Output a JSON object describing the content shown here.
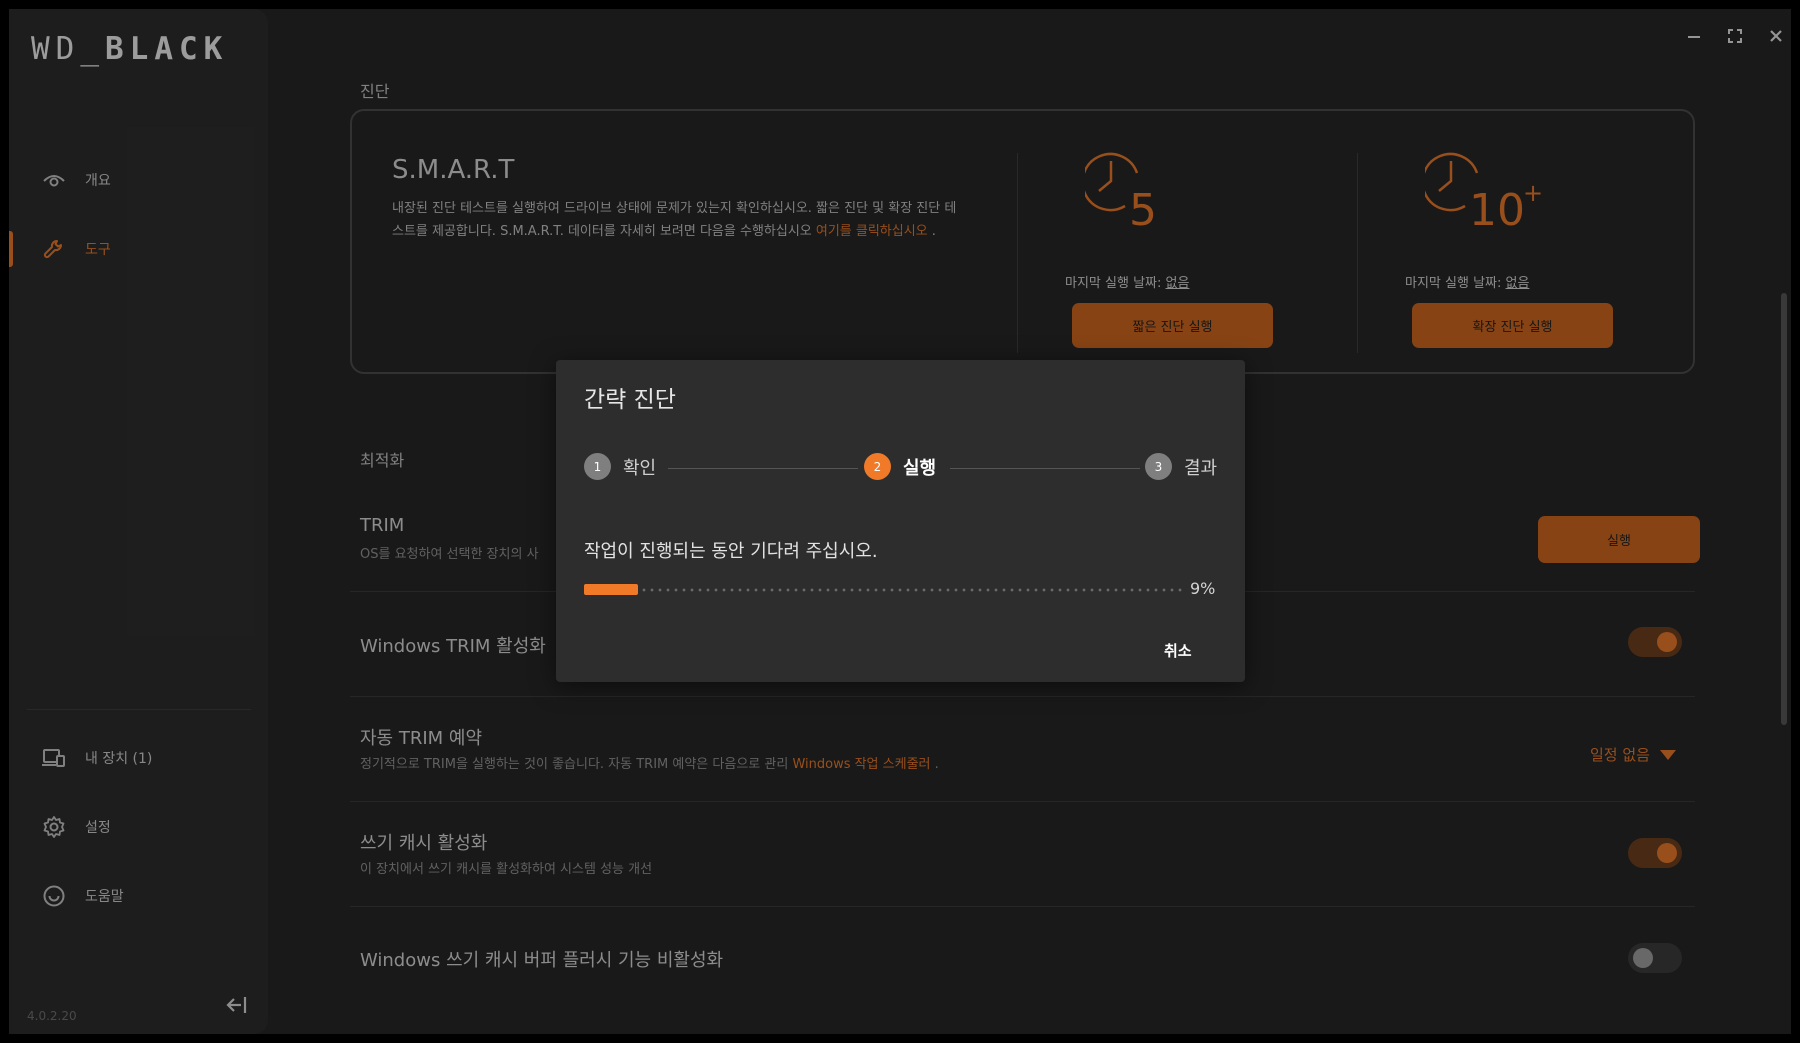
{
  "app": {
    "logo_text": "WD_BLACK",
    "version": "4.0.2.20",
    "accent_color": "#e0752a"
  },
  "sidebar": {
    "items": [
      {
        "label": "개요",
        "icon": "eye-icon"
      },
      {
        "label": "도구",
        "icon": "wrench-icon",
        "active": true
      }
    ],
    "bottom_items": [
      {
        "label": "내 장치 (1)",
        "icon": "devices-icon"
      },
      {
        "label": "설정",
        "icon": "gear-icon"
      },
      {
        "label": "도움말",
        "icon": "help-icon"
      }
    ]
  },
  "diagnostics": {
    "section_label": "진단",
    "smart": {
      "title": "S.M.A.R.T",
      "description": "내장된 진단 테스트를 실행하여 드라이브 상태에 문제가 있는지 확인하십시오. 짧은 진단 및 확장 진단 테스트를 제공합니다. S.M.A.R.T. 데이터를 자세히 보려면 다음을 수행하십시오 ",
      "link_text": "여기를 클릭하십시오",
      "link_suffix": " ."
    },
    "short_test": {
      "icon_number": "5",
      "last_run_label": "마지막 실행 날짜: ",
      "last_run_value": "없음",
      "button": "짧은 진단 실행"
    },
    "extended_test": {
      "icon_number": "10",
      "icon_sup": "+",
      "last_run_label": "마지막 실행 날짜: ",
      "last_run_value": "없음",
      "button": "확장 진단 실행"
    }
  },
  "optimization": {
    "section_label": "최적화",
    "trim": {
      "title": "TRIM",
      "subtitle": "OS를 요청하여 선택한 장치의 사",
      "button": "실행"
    },
    "windows_trim": {
      "title": "Windows TRIM 활성화",
      "enabled": true
    },
    "auto_trim": {
      "title": "자동 TRIM 예약",
      "subtitle": "정기적으로 TRIM을 실행하는 것이 좋습니다. 자동 TRIM 예약은 다음으로 관리 ",
      "link_text": "Windows 작업 스케줄러",
      "link_suffix": " .",
      "schedule_value": "일정 없음"
    },
    "write_cache": {
      "title": "쓰기 캐시 활성화",
      "subtitle": "이 장치에서 쓰기 캐시를 활성화하여 시스템 성능 개선",
      "enabled": true
    },
    "buffer_flush": {
      "title": "Windows 쓰기 캐시 버퍼 플러시 기능 비활성화",
      "enabled": false
    }
  },
  "modal": {
    "title": "간략 진단",
    "steps": [
      {
        "num": "1",
        "label": "확인",
        "state": "done"
      },
      {
        "num": "2",
        "label": "실행",
        "state": "current"
      },
      {
        "num": "3",
        "label": "결과",
        "state": "pending"
      }
    ],
    "message": "작업이 진행되는 동안 기다려 주십시오.",
    "progress_percent": 9,
    "progress_text": "9%",
    "cancel_label": "취소"
  }
}
